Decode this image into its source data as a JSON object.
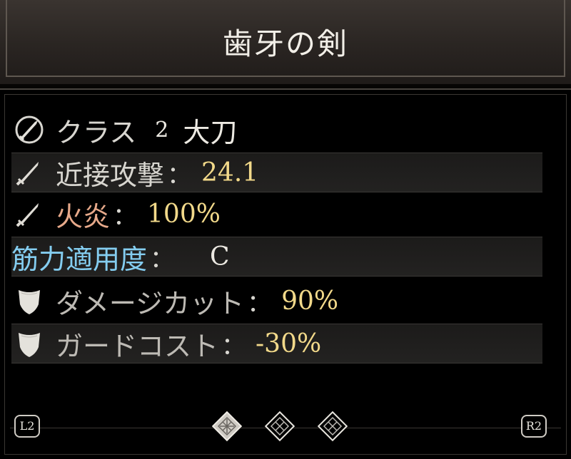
{
  "title": "歯牙の剣",
  "class_row": {
    "label": "クラス",
    "number": "2",
    "name": "大刀",
    "icon": "greatsword-class-icon"
  },
  "stats": [
    {
      "label": "近接攻撃",
      "colon": "：",
      "value": "24.1",
      "icon": "sword-icon"
    },
    {
      "label": "火炎",
      "colon": "：",
      "value": "100%",
      "icon": "sword-icon"
    },
    {
      "label": "筋力適用度",
      "colon": "：",
      "value": "C",
      "icon": ""
    },
    {
      "label": "ダメージカット",
      "colon": "：",
      "value": "90%",
      "icon": "shield-icon"
    },
    {
      "label": "ガードコスト",
      "colon": "：",
      "value": "-30%",
      "icon": "shield-icon"
    }
  ],
  "nav": {
    "left_button": "L2",
    "right_button": "R2",
    "page_count": 3,
    "active_page": 1
  },
  "colors": {
    "value_gold": "#f2d98a",
    "fire_label": "#e7a98a",
    "scaling_label": "#84cdf0",
    "text_light": "#d8d6d0"
  }
}
